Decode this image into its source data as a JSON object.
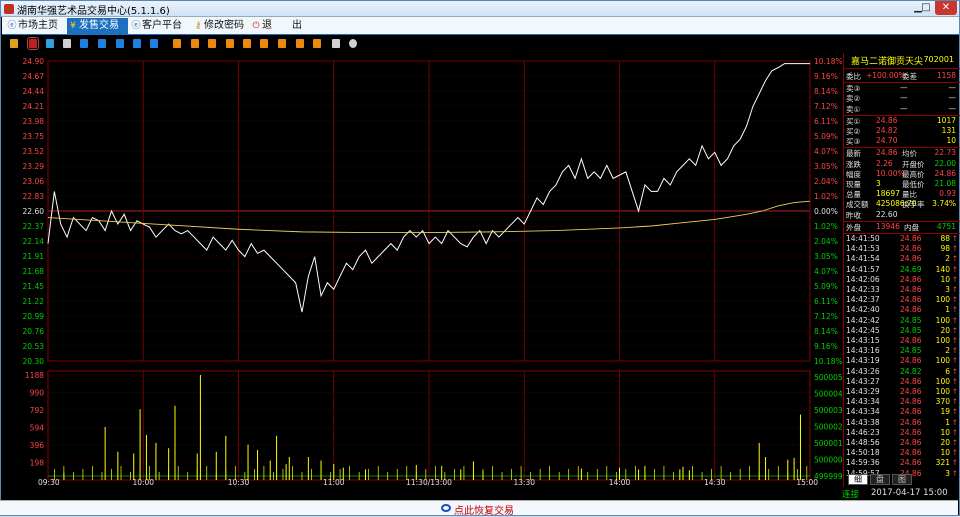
{
  "window": {
    "title": "湖南华强艺术品交易中心(5.1.1.6)"
  },
  "menu": [
    {
      "label": "市场主页",
      "icon": "e-icon"
    },
    {
      "label": "发售交易",
      "icon": "yen-icon",
      "active": true
    },
    {
      "label": "客户平台",
      "icon": "e-icon"
    },
    {
      "label": "修改密码",
      "icon": "key-icon"
    },
    {
      "label": "退　　出",
      "icon": "power-icon"
    }
  ],
  "chart_data": {
    "type": "line",
    "title": "",
    "xlabel": "",
    "ylabel": "",
    "time_ticks": [
      "09:30",
      "10:00",
      "10:30",
      "11:00",
      "11:30/13:00",
      "13:30",
      "14:00",
      "14:30",
      "15:00"
    ],
    "price_ticks": [
      "24.90",
      "24.67",
      "24.44",
      "24.21",
      "23.98",
      "23.75",
      "23.52",
      "23.29",
      "23.06",
      "22.83",
      "22.60",
      "22.37",
      "22.14",
      "21.91",
      "21.68",
      "21.45",
      "21.22",
      "20.99",
      "20.76",
      "20.53",
      "20.30"
    ],
    "pct_ticks": [
      "10.18%",
      "9.16%",
      "8.14%",
      "7.12%",
      "6.11%",
      "5.09%",
      "4.07%",
      "3.05%",
      "2.04%",
      "1.02%",
      "0.00%",
      "1.02%",
      "2.04%",
      "3.05%",
      "4.07%",
      "5.09%",
      "6.11%",
      "7.12%",
      "8.14%",
      "9.16%",
      "10.18%"
    ],
    "vol_ticks": [
      "1188",
      "990",
      "792",
      "594",
      "396",
      "198"
    ],
    "vol_right_ticks": [
      "500005",
      "500004",
      "500003",
      "500002",
      "500001",
      "500000",
      "499999"
    ],
    "ylim": [
      20.3,
      24.9
    ],
    "prev_close": 22.6,
    "series": [
      {
        "color": "#ffffff",
        "x": [
          0,
          2,
          4,
          6,
          8,
          10,
          12,
          14,
          16,
          18,
          20,
          22,
          24,
          26,
          28,
          30,
          32,
          34,
          36,
          38,
          40,
          42,
          44,
          46,
          48,
          50,
          52,
          54,
          56,
          58,
          60,
          62,
          64,
          66,
          68,
          70,
          72,
          74,
          76,
          78,
          80,
          82,
          84,
          86,
          88,
          90,
          92,
          94,
          96,
          98,
          100,
          102,
          104,
          106,
          108,
          110,
          112,
          114,
          116,
          118,
          120,
          122,
          124,
          126,
          128,
          130,
          132,
          134,
          136,
          138,
          140,
          142,
          144,
          146,
          148,
          150,
          152,
          154,
          156,
          158,
          160,
          162,
          164,
          166,
          168,
          170,
          172,
          174,
          176,
          178,
          180,
          182,
          184,
          186,
          188,
          190,
          192,
          194,
          196,
          198,
          200,
          202,
          204,
          206,
          208,
          210,
          212,
          214,
          216,
          218,
          220,
          222,
          224,
          226,
          228,
          230,
          232,
          234,
          236,
          238,
          240
        ],
        "values": [
          22.1,
          22.9,
          22.4,
          22.2,
          22.5,
          22.4,
          22.3,
          22.5,
          22.45,
          22.3,
          22.6,
          22.4,
          22.55,
          22.3,
          22.45,
          22.4,
          22.35,
          22.2,
          22.3,
          22.4,
          22.3,
          22.25,
          22.3,
          22.2,
          22.1,
          22.0,
          22.2,
          22.1,
          22.0,
          22.15,
          22.0,
          21.9,
          22.1,
          21.95,
          22.0,
          21.9,
          21.8,
          21.7,
          21.6,
          21.5,
          21.05,
          21.6,
          21.9,
          21.3,
          21.5,
          21.4,
          21.6,
          21.8,
          21.7,
          21.9,
          22.0,
          21.8,
          21.9,
          22.0,
          22.1,
          22.0,
          22.2,
          22.3,
          22.2,
          22.3,
          22.1,
          22.2,
          22.1,
          22.3,
          22.2,
          22.1,
          22.05,
          22.2,
          22.3,
          22.1,
          22.3,
          22.2,
          22.3,
          22.4,
          22.5,
          22.4,
          22.6,
          22.8,
          22.7,
          22.9,
          23.0,
          23.2,
          23.3,
          23.1,
          23.4,
          23.1,
          23.2,
          23.1,
          23.3,
          23.1,
          23.15,
          23.2,
          22.9,
          22.6,
          23.0,
          22.9,
          22.9,
          23.1,
          23.0,
          23.2,
          23.3,
          23.4,
          23.3,
          23.6,
          23.4,
          23.5,
          23.3,
          23.4,
          23.6,
          23.7,
          23.9,
          24.2,
          24.4,
          24.6,
          24.75,
          24.8,
          24.86,
          24.86,
          24.86,
          24.86,
          24.86
        ]
      },
      {
        "color": "#e8d060",
        "x": [
          0,
          20,
          40,
          60,
          80,
          100,
          120,
          140,
          160,
          180,
          190,
          200,
          210,
          220,
          225,
          230,
          235,
          240
        ],
        "values": [
          22.5,
          22.44,
          22.38,
          22.32,
          22.28,
          22.27,
          22.27,
          22.28,
          22.3,
          22.34,
          22.37,
          22.42,
          22.47,
          22.55,
          22.6,
          22.68,
          22.73,
          22.75
        ]
      }
    ],
    "volume": [
      {
        "x": [
          5,
          18,
          22,
          27,
          29,
          31,
          34,
          38,
          40,
          47,
          48,
          53,
          56,
          63,
          66,
          70,
          72,
          75,
          76,
          82,
          86,
          90,
          93,
          100,
          116,
          124,
          130,
          134,
          137,
          168,
          180,
          186,
          188,
          199,
          200,
          202,
          224,
          226,
          233,
          235,
          237
        ],
        "v": [
          80,
          600,
          320,
          300,
          800,
          510,
          420,
          360,
          840,
          300,
          1188,
          320,
          500,
          400,
          340,
          220,
          500,
          180,
          260,
          260,
          220,
          180,
          140,
          120,
          170,
          160,
          120,
          210,
          100,
          130,
          140,
          120,
          160,
          120,
          150,
          110,
          420,
          260,
          230,
          250,
          740
        ]
      }
    ]
  },
  "side": {
    "name": "嘉马二诺御贡天尖",
    "code": "702001",
    "weibi": {
      "label": "委比",
      "value": "+100.00%",
      "label2": "委差",
      "value2": "1158"
    },
    "sells": [
      {
        "label": "卖③",
        "price": "—",
        "vol": "—"
      },
      {
        "label": "卖②",
        "price": "—",
        "vol": "—"
      },
      {
        "label": "卖①",
        "price": "—",
        "vol": "—"
      }
    ],
    "buys": [
      {
        "label": "买①",
        "price": "24.86",
        "vol": "1017"
      },
      {
        "label": "买②",
        "price": "24.82",
        "vol": "131"
      },
      {
        "label": "买③",
        "price": "24.70",
        "vol": "10"
      }
    ],
    "stats": [
      {
        "l1": "最新",
        "v1": "24.86",
        "l2": "均价",
        "v2": "22.73"
      },
      {
        "l1": "涨跌",
        "v1": "2.26",
        "l2": "开盘价",
        "v2": "22.00"
      },
      {
        "l1": "幅度",
        "v1": "10.00%",
        "l2": "最高价",
        "v2": "24.86"
      },
      {
        "l1": "现量",
        "v1": "3",
        "l2": "最低价",
        "v2": "21.08"
      },
      {
        "l1": "总量",
        "v1": "18697",
        "l2": "量比",
        "v2": "0.93"
      },
      {
        "l1": "成交额",
        "v1": "425086.70",
        "l2": "换手率",
        "v2": "3.74%"
      },
      {
        "l1": "昨收",
        "v1": "22.60",
        "l2": "",
        "v2": ""
      }
    ],
    "outer": {
      "label": "外盘",
      "value": "13946",
      "label2": "内盘",
      "value2": "4751"
    },
    "ticks": [
      [
        "14:41:50",
        "24.86",
        "88"
      ],
      [
        "14:41:53",
        "24.86",
        "98"
      ],
      [
        "14:41:54",
        "24.86",
        "2"
      ],
      [
        "14:41:57",
        "24.69",
        "140"
      ],
      [
        "14:42:06",
        "24.86",
        "10"
      ],
      [
        "14:42:33",
        "24.86",
        "3"
      ],
      [
        "14:42:37",
        "24.86",
        "100"
      ],
      [
        "14:42:40",
        "24.86",
        "1"
      ],
      [
        "14:42:42",
        "24.85",
        "100"
      ],
      [
        "14:42:45",
        "24.85",
        "20"
      ],
      [
        "14:43:15",
        "24.86",
        "100"
      ],
      [
        "14:43:16",
        "24.85",
        "2"
      ],
      [
        "14:43:19",
        "24.86",
        "100"
      ],
      [
        "14:43:26",
        "24.82",
        "6"
      ],
      [
        "14:43:27",
        "24.86",
        "100"
      ],
      [
        "14:43:29",
        "24.86",
        "100"
      ],
      [
        "14:43:34",
        "24.86",
        "370"
      ],
      [
        "14:43:34",
        "24.86",
        "19"
      ],
      [
        "14:43:38",
        "24.86",
        "1"
      ],
      [
        "14:46:23",
        "24.86",
        "10"
      ],
      [
        "14:48:56",
        "24.86",
        "20"
      ],
      [
        "14:50:18",
        "24.86",
        "10"
      ],
      [
        "14:59:36",
        "24.86",
        "321"
      ],
      [
        "14:59:57",
        "24.86",
        "3"
      ]
    ],
    "tabs": [
      "细",
      "盘",
      "图"
    ]
  },
  "status": {
    "conn": "连接",
    "datetime": "2017-04-17 15:00"
  },
  "restore": {
    "label": "点此恢复交易"
  }
}
